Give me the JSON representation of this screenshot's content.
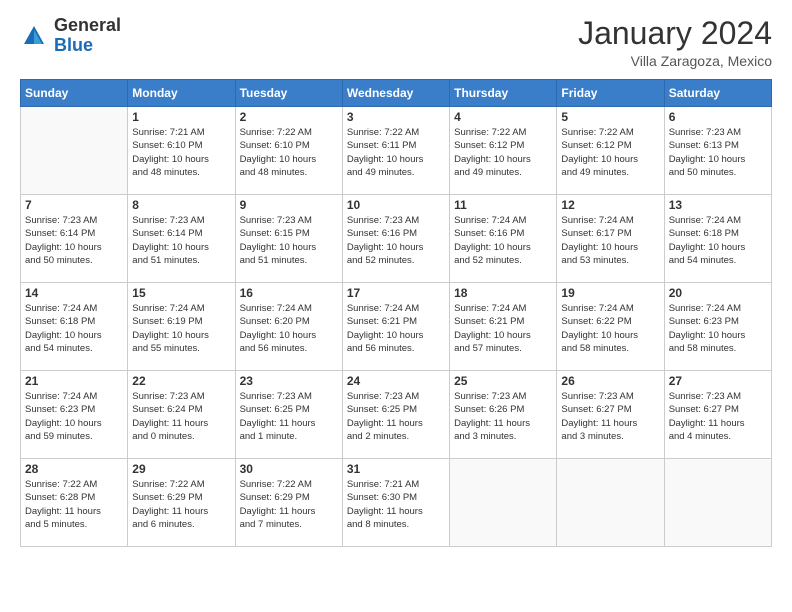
{
  "logo": {
    "general": "General",
    "blue": "Blue"
  },
  "header": {
    "month_year": "January 2024",
    "location": "Villa Zaragoza, Mexico"
  },
  "days_of_week": [
    "Sunday",
    "Monday",
    "Tuesday",
    "Wednesday",
    "Thursday",
    "Friday",
    "Saturday"
  ],
  "weeks": [
    [
      {
        "day": "",
        "info": ""
      },
      {
        "day": "1",
        "info": "Sunrise: 7:21 AM\nSunset: 6:10 PM\nDaylight: 10 hours\nand 48 minutes."
      },
      {
        "day": "2",
        "info": "Sunrise: 7:22 AM\nSunset: 6:10 PM\nDaylight: 10 hours\nand 48 minutes."
      },
      {
        "day": "3",
        "info": "Sunrise: 7:22 AM\nSunset: 6:11 PM\nDaylight: 10 hours\nand 49 minutes."
      },
      {
        "day": "4",
        "info": "Sunrise: 7:22 AM\nSunset: 6:12 PM\nDaylight: 10 hours\nand 49 minutes."
      },
      {
        "day": "5",
        "info": "Sunrise: 7:22 AM\nSunset: 6:12 PM\nDaylight: 10 hours\nand 49 minutes."
      },
      {
        "day": "6",
        "info": "Sunrise: 7:23 AM\nSunset: 6:13 PM\nDaylight: 10 hours\nand 50 minutes."
      }
    ],
    [
      {
        "day": "7",
        "info": "Sunrise: 7:23 AM\nSunset: 6:14 PM\nDaylight: 10 hours\nand 50 minutes."
      },
      {
        "day": "8",
        "info": "Sunrise: 7:23 AM\nSunset: 6:14 PM\nDaylight: 10 hours\nand 51 minutes."
      },
      {
        "day": "9",
        "info": "Sunrise: 7:23 AM\nSunset: 6:15 PM\nDaylight: 10 hours\nand 51 minutes."
      },
      {
        "day": "10",
        "info": "Sunrise: 7:23 AM\nSunset: 6:16 PM\nDaylight: 10 hours\nand 52 minutes."
      },
      {
        "day": "11",
        "info": "Sunrise: 7:24 AM\nSunset: 6:16 PM\nDaylight: 10 hours\nand 52 minutes."
      },
      {
        "day": "12",
        "info": "Sunrise: 7:24 AM\nSunset: 6:17 PM\nDaylight: 10 hours\nand 53 minutes."
      },
      {
        "day": "13",
        "info": "Sunrise: 7:24 AM\nSunset: 6:18 PM\nDaylight: 10 hours\nand 54 minutes."
      }
    ],
    [
      {
        "day": "14",
        "info": "Sunrise: 7:24 AM\nSunset: 6:18 PM\nDaylight: 10 hours\nand 54 minutes."
      },
      {
        "day": "15",
        "info": "Sunrise: 7:24 AM\nSunset: 6:19 PM\nDaylight: 10 hours\nand 55 minutes."
      },
      {
        "day": "16",
        "info": "Sunrise: 7:24 AM\nSunset: 6:20 PM\nDaylight: 10 hours\nand 56 minutes."
      },
      {
        "day": "17",
        "info": "Sunrise: 7:24 AM\nSunset: 6:21 PM\nDaylight: 10 hours\nand 56 minutes."
      },
      {
        "day": "18",
        "info": "Sunrise: 7:24 AM\nSunset: 6:21 PM\nDaylight: 10 hours\nand 57 minutes."
      },
      {
        "day": "19",
        "info": "Sunrise: 7:24 AM\nSunset: 6:22 PM\nDaylight: 10 hours\nand 58 minutes."
      },
      {
        "day": "20",
        "info": "Sunrise: 7:24 AM\nSunset: 6:23 PM\nDaylight: 10 hours\nand 58 minutes."
      }
    ],
    [
      {
        "day": "21",
        "info": "Sunrise: 7:24 AM\nSunset: 6:23 PM\nDaylight: 10 hours\nand 59 minutes."
      },
      {
        "day": "22",
        "info": "Sunrise: 7:23 AM\nSunset: 6:24 PM\nDaylight: 11 hours\nand 0 minutes."
      },
      {
        "day": "23",
        "info": "Sunrise: 7:23 AM\nSunset: 6:25 PM\nDaylight: 11 hours\nand 1 minute."
      },
      {
        "day": "24",
        "info": "Sunrise: 7:23 AM\nSunset: 6:25 PM\nDaylight: 11 hours\nand 2 minutes."
      },
      {
        "day": "25",
        "info": "Sunrise: 7:23 AM\nSunset: 6:26 PM\nDaylight: 11 hours\nand 3 minutes."
      },
      {
        "day": "26",
        "info": "Sunrise: 7:23 AM\nSunset: 6:27 PM\nDaylight: 11 hours\nand 3 minutes."
      },
      {
        "day": "27",
        "info": "Sunrise: 7:23 AM\nSunset: 6:27 PM\nDaylight: 11 hours\nand 4 minutes."
      }
    ],
    [
      {
        "day": "28",
        "info": "Sunrise: 7:22 AM\nSunset: 6:28 PM\nDaylight: 11 hours\nand 5 minutes."
      },
      {
        "day": "29",
        "info": "Sunrise: 7:22 AM\nSunset: 6:29 PM\nDaylight: 11 hours\nand 6 minutes."
      },
      {
        "day": "30",
        "info": "Sunrise: 7:22 AM\nSunset: 6:29 PM\nDaylight: 11 hours\nand 7 minutes."
      },
      {
        "day": "31",
        "info": "Sunrise: 7:21 AM\nSunset: 6:30 PM\nDaylight: 11 hours\nand 8 minutes."
      },
      {
        "day": "",
        "info": ""
      },
      {
        "day": "",
        "info": ""
      },
      {
        "day": "",
        "info": ""
      }
    ]
  ]
}
